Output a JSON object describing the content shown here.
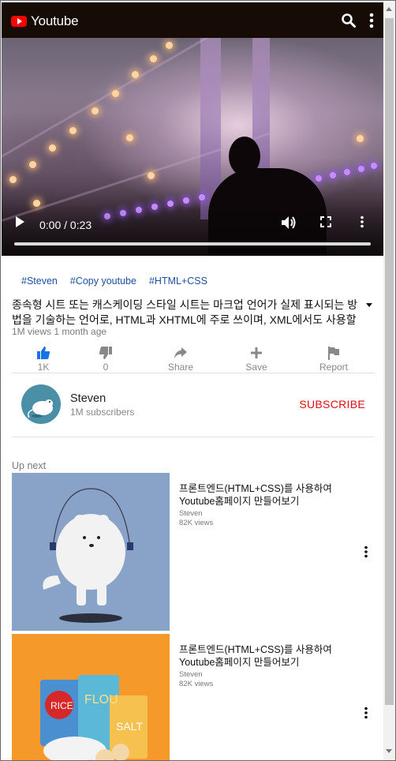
{
  "app": {
    "title": "Youtube"
  },
  "header": {
    "icons": [
      "search-icon",
      "more-vert-icon"
    ]
  },
  "player": {
    "time": "0:00 / 0:23",
    "progress": 0
  },
  "tags": [
    "#Steven",
    "#Copy youtube",
    "#HTML+CSS"
  ],
  "video": {
    "description": "종속형 시트 또는 캐스케이딩 스타일 시트는 마크업 언어가 실제 표시되는 방법을 기술하는 언어로, HTML과 XHTML에 주로 쓰이며, XML에서도 사용할 수 있다.",
    "meta": "1M views 1 month age"
  },
  "actions": [
    {
      "label": "1K",
      "icon": "thumbs-up-icon",
      "color": "#1a73e8"
    },
    {
      "label": "0",
      "icon": "thumbs-down-icon",
      "color": "#888888"
    },
    {
      "label": "Share",
      "icon": "share-icon",
      "color": "#888888"
    },
    {
      "label": "Save",
      "icon": "add-icon",
      "color": "#888888"
    },
    {
      "label": "Report",
      "icon": "flag-icon",
      "color": "#888888"
    }
  ],
  "channel": {
    "name": "Steven",
    "subscribers": "1M subscribers",
    "subscribe_label": "SUBSCRIBE"
  },
  "up_next": {
    "label": "Up next",
    "items": [
      {
        "title": "프론트엔드(HTML+CSS)를 사용하여 Youtube홈페이지 만들어보기",
        "channel": "Steven",
        "views": "82K views",
        "thumb_bg": "#89a2c7"
      },
      {
        "title": "프론트엔드(HTML+CSS)를 사용하여 Youtube홈페이지 만들어보기",
        "channel": "Steven",
        "views": "82K views",
        "thumb_bg": "#f59a2a"
      }
    ]
  },
  "colors": {
    "header_bg": "#160c05",
    "subscribe": "#e50914",
    "tag": "#1e4e9e",
    "like": "#1a73e8"
  }
}
